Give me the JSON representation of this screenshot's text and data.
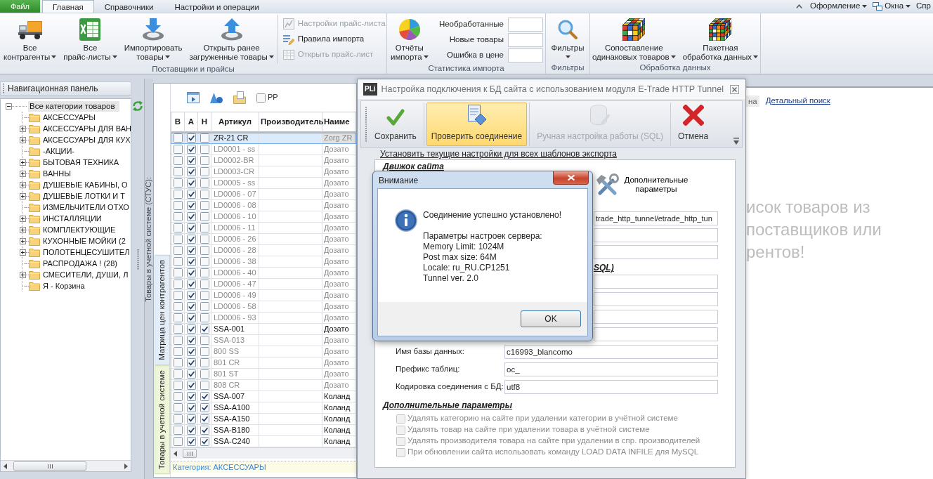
{
  "ribbon_tabs": [
    {
      "kind": "file",
      "label": "Файл",
      "selected": false
    },
    {
      "kind": "tab",
      "label": "Главная",
      "selected": true
    },
    {
      "kind": "tab",
      "label": "Справочники",
      "selected": false
    },
    {
      "kind": "tab",
      "label": "Настройки и операции",
      "selected": false
    }
  ],
  "ribbon_menus": [
    {
      "kind": "appearance",
      "label": "Оформление",
      "dropdown": true
    },
    {
      "kind": "windows",
      "label": "Окна",
      "dropdown": true
    },
    {
      "kind": "help",
      "label": "Спр",
      "dropdown": false
    }
  ],
  "ribbon_groups": [
    {
      "label": "Поставщики и прайсы",
      "large_buttons": [
        {
          "lines": [
            "Все",
            "контрагенты"
          ],
          "dropdown": true
        },
        {
          "lines": [
            "Все",
            "прайс-листы"
          ],
          "dropdown": true
        },
        {
          "lines": [
            "Импортировать",
            "товары"
          ],
          "dropdown": true
        },
        {
          "lines": [
            "Открыть ранее",
            "загруженные товары"
          ],
          "dropdown": true
        }
      ],
      "small_buttons": [
        {
          "label": "Настройки прайс-листа",
          "disabled": true
        },
        {
          "label": "Правила импорта",
          "disabled": false
        },
        {
          "label": "Открыть прайс-лист",
          "disabled": true
        }
      ]
    },
    {
      "label": "Статистика импорта",
      "large_buttons": [
        {
          "lines": [
            "Отчёты",
            "импорта"
          ],
          "dropdown": true
        }
      ],
      "counters": [
        {
          "label": "Необработанные"
        },
        {
          "label": "Новые товары"
        },
        {
          "label": "Ошибка в цене"
        }
      ]
    },
    {
      "label": "Фильтры",
      "large_buttons": [
        {
          "lines": [
            "Фильтры"
          ],
          "dropdown": true
        }
      ]
    },
    {
      "label": "Обработка данных",
      "large_buttons": [
        {
          "lines": [
            "Сопоставление",
            "одинаковых товаров"
          ],
          "dropdown": true
        },
        {
          "lines": [
            "Пакетная",
            "обработка данных"
          ],
          "dropdown": true
        }
      ]
    }
  ],
  "nav_panel": {
    "title": "Навигационная панель",
    "tree": [
      {
        "label": "Все категории товаров",
        "expandable": true,
        "expanded": true,
        "selected": true,
        "children": [
          {
            "label": "АКСЕССУАРЫ",
            "expandable": false,
            "selected": false
          },
          {
            "label": "АКСЕССУАРЫ ДЛЯ ВАН",
            "expandable": true,
            "expanded": false,
            "selected": false
          },
          {
            "label": "АКСЕССУАРЫ ДЛЯ КУХ",
            "expandable": true,
            "expanded": false,
            "selected": false
          },
          {
            "label": "-АКЦИИ-",
            "expandable": false,
            "selected": false
          },
          {
            "label": "БЫТОВАЯ ТЕХНИКА",
            "expandable": true,
            "expanded": false,
            "selected": false
          },
          {
            "label": "ВАННЫ",
            "expandable": true,
            "expanded": false,
            "selected": false
          },
          {
            "label": "ДУШЕВЫЕ КАБИНЫ, О",
            "expandable": true,
            "expanded": false,
            "selected": false
          },
          {
            "label": "ДУШЕВЫЕ ЛОТКИ И Т",
            "expandable": true,
            "expanded": false,
            "selected": false
          },
          {
            "label": "ИЗМЕЛЬЧИТЕЛИ ОТХО",
            "expandable": false,
            "selected": false
          },
          {
            "label": "ИНСТАЛЛЯЦИИ",
            "expandable": true,
            "expanded": false,
            "selected": false
          },
          {
            "label": "КОМПЛЕКТУЮЩИЕ",
            "expandable": true,
            "expanded": false,
            "selected": false
          },
          {
            "label": "КУХОННЫЕ МОЙКИ (2",
            "expandable": true,
            "expanded": false,
            "selected": false
          },
          {
            "label": "ПОЛОТЕНЦЕСУШИТЕЛ",
            "expandable": true,
            "expanded": false,
            "selected": false
          },
          {
            "label": "РАСПРОДАЖА ! (28)",
            "expandable": false,
            "selected": false
          },
          {
            "label": "СМЕСИТЕЛИ, ДУШИ, Л",
            "expandable": true,
            "expanded": false,
            "selected": false
          },
          {
            "label": "Я - Корзина",
            "expandable": false,
            "selected": false
          }
        ]
      }
    ]
  },
  "side_strip": {
    "label": "Товары в учетной системе (СТУС):"
  },
  "grid_panel": {
    "side_tabs": [
      {
        "label": "Матрица цен контрагентов",
        "selected": false
      },
      {
        "label": "Товары в учетной системе",
        "selected": true
      }
    ],
    "pp_checkbox": {
      "label": "PP",
      "checked": false
    },
    "columns": [
      "В",
      "А",
      "Н",
      "Артикул",
      "Производитель",
      "Наиме"
    ],
    "rows": [
      {
        "checks": [
          false,
          true,
          false
        ],
        "article": "ZR-21 CR",
        "name": "Zorg ZR",
        "selected": true
      },
      {
        "checks": [
          false,
          true,
          false
        ],
        "article": "LD0001 - ss",
        "name": "Дозато",
        "selected": false
      },
      {
        "checks": [
          false,
          true,
          false
        ],
        "article": "LD0002-BR",
        "name": "Дозато",
        "selected": false
      },
      {
        "checks": [
          false,
          true,
          false
        ],
        "article": "LD0003-CR",
        "name": "Дозато",
        "selected": false
      },
      {
        "checks": [
          false,
          true,
          false
        ],
        "article": "LD0005 - ss",
        "name": "Дозато",
        "selected": false
      },
      {
        "checks": [
          false,
          true,
          false
        ],
        "article": "LD0006 - 07",
        "name": "Дозато",
        "selected": false
      },
      {
        "checks": [
          false,
          true,
          false
        ],
        "article": "LD0006 - 08",
        "name": "Дозато",
        "selected": false
      },
      {
        "checks": [
          false,
          true,
          false
        ],
        "article": "LD0006 - 10",
        "name": "Дозато",
        "selected": false
      },
      {
        "checks": [
          false,
          true,
          false
        ],
        "article": "LD0006 - 11",
        "name": "Дозато",
        "selected": false
      },
      {
        "checks": [
          false,
          true,
          false
        ],
        "article": "LD0006 - 26",
        "name": "Дозато",
        "selected": false
      },
      {
        "checks": [
          false,
          true,
          false
        ],
        "article": "LD0006 - 28",
        "name": "Дозато",
        "selected": false
      },
      {
        "checks": [
          false,
          true,
          false
        ],
        "article": "LD0006 - 38",
        "name": "Дозато",
        "selected": false
      },
      {
        "checks": [
          false,
          true,
          false
        ],
        "article": "LD0006 - 40",
        "name": "Дозато",
        "selected": false
      },
      {
        "checks": [
          false,
          true,
          false
        ],
        "article": "LD0006 - 47",
        "name": "Дозато",
        "selected": false
      },
      {
        "checks": [
          false,
          true,
          false
        ],
        "article": "LD0006 - 49",
        "name": "Дозато",
        "selected": false
      },
      {
        "checks": [
          false,
          true,
          false
        ],
        "article": "LD0006 - 58",
        "name": "Дозато",
        "selected": false
      },
      {
        "checks": [
          false,
          true,
          false
        ],
        "article": "LD0006 - 93",
        "name": "Дозато",
        "selected": false
      },
      {
        "checks": [
          false,
          true,
          true
        ],
        "article": "SSA-001",
        "name": "Дозато",
        "selected": false
      },
      {
        "checks": [
          false,
          true,
          false
        ],
        "article": "SSA-013",
        "name": "Дозато",
        "selected": false
      },
      {
        "checks": [
          false,
          true,
          false
        ],
        "article": "800 SS",
        "name": "Дозато",
        "selected": false
      },
      {
        "checks": [
          false,
          true,
          false
        ],
        "article": "801 CR",
        "name": "Дозато",
        "selected": false
      },
      {
        "checks": [
          false,
          true,
          false
        ],
        "article": "801 ST",
        "name": "Дозато",
        "selected": false
      },
      {
        "checks": [
          false,
          true,
          false
        ],
        "article": "808 CR",
        "name": "Дозато",
        "selected": false
      },
      {
        "checks": [
          false,
          true,
          true
        ],
        "article": "SSA-007",
        "name": "Коланд",
        "selected": false
      },
      {
        "checks": [
          false,
          true,
          true
        ],
        "article": "SSA-A100",
        "name": "Коланд",
        "selected": false
      },
      {
        "checks": [
          false,
          true,
          true
        ],
        "article": "SSA-A150",
        "name": "Коланд",
        "selected": false
      },
      {
        "checks": [
          false,
          true,
          true
        ],
        "article": "SSA-B180",
        "name": "Коланд",
        "selected": false
      },
      {
        "checks": [
          false,
          true,
          true
        ],
        "article": "SSA-C240",
        "name": "Коланд",
        "selected": false
      }
    ],
    "footer": "Категория: АКСЕССУАРЫ"
  },
  "dialog": {
    "logo": "PLi",
    "title": "Настройка подключения к БД сайта с использованием модуля E-Trade HTTP Tunnel",
    "toolbar": [
      {
        "label": "Сохранить",
        "selected": false,
        "disabled": false
      },
      {
        "label": "Проверить соединение",
        "selected": true,
        "disabled": false
      },
      {
        "label": "Ручная настройка работы (SQL)",
        "selected": false,
        "disabled": true
      },
      {
        "label": "Отмена",
        "selected": false,
        "disabled": false
      }
    ],
    "link": "Установить текущие настройки для всех шаблонов экспорта",
    "engine_heading": "Движок сайта",
    "extra_button": "Дополнительные параметры",
    "fields": [
      {
        "kind": "covered",
        "value": "trade_http_tunnel/etrade_http_tun"
      },
      {
        "kind": "covered"
      },
      {
        "kind": "covered"
      },
      {
        "kind": "heading",
        "label": "SQL)"
      },
      {
        "kind": "covered"
      },
      {
        "kind": "covered"
      },
      {
        "kind": "covered"
      },
      {
        "kind": "covered"
      },
      {
        "kind": "labeled",
        "label": "Имя базы данных:",
        "value": "c16993_blancomo"
      },
      {
        "kind": "labeled",
        "label": "Префикс таблиц:",
        "value": "oc_"
      },
      {
        "kind": "labeled",
        "label": "Кодировка соединения с БД:",
        "value": "utf8"
      }
    ],
    "extra_heading": "Дополнительные параметры",
    "options": [
      {
        "label": "Удалять категорию на сайте при удалении категории в учётной системе",
        "checked": false,
        "disabled": true
      },
      {
        "label": "Удалять товар на сайте при удалении товара в учётной системе",
        "checked": false,
        "disabled": true
      },
      {
        "label": "Удалять производителя товара на сайте при удалении в спр. производителей",
        "checked": false,
        "disabled": true
      },
      {
        "label": "При обновлении сайта использовать команду LOAD DATA INFILE для MySQL",
        "checked": false,
        "disabled": true
      }
    ]
  },
  "message_box": {
    "title": "Внимание",
    "message": "Соединение успешно установлено!",
    "details": [
      "Параметры настроек сервера:",
      "Memory Limit: 1024M",
      "Post max size: 64M",
      "Locale: ru_RU.CP1251",
      "Tunnel ver. 2.0"
    ],
    "button": "OK"
  },
  "right_panel": {
    "cut_button": "на",
    "link": "Детальный поиск",
    "hint_lines": [
      "исок товаров из",
      "поставщиков или",
      "рентов!"
    ]
  }
}
